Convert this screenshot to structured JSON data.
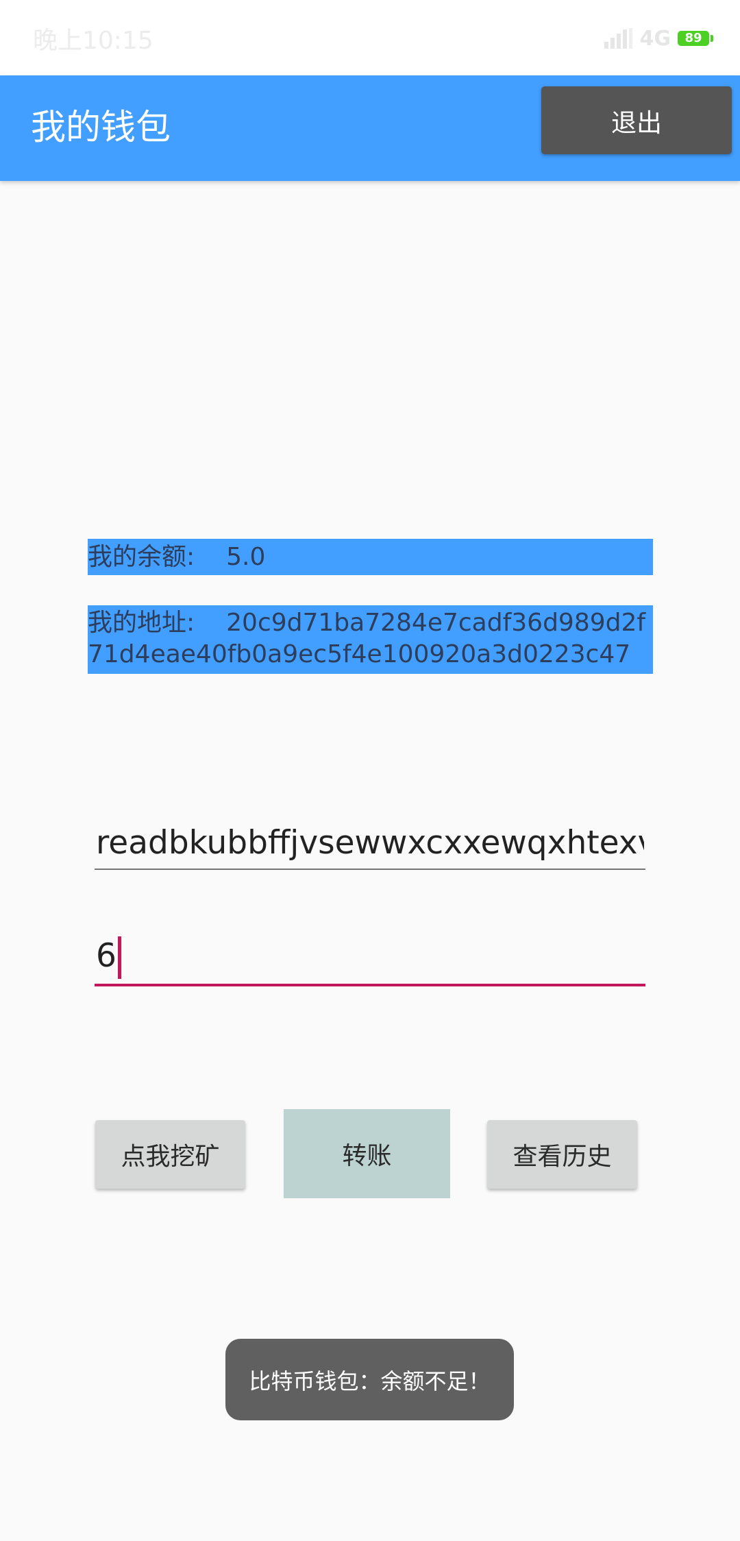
{
  "status_bar": {
    "time": "晚上10:15",
    "network": "4G",
    "battery": "89",
    "icons": [
      "signal-icon",
      "battery-icon"
    ]
  },
  "app_bar": {
    "title": "我的钱包",
    "logout_label": "退出",
    "color": "#429EFF"
  },
  "wallet": {
    "balance_label": "我的余额:",
    "balance_value": "5.0",
    "address_label": "我的地址:",
    "address_value": "20c9d71ba7284e7cadf36d989d2f71d4eae40fb0a9ec5f4e100920a3d0223c47"
  },
  "form": {
    "recipient_value": "readbkubbffjvsewwxcxxewqxhtexvu",
    "amount_value": "6"
  },
  "buttons": {
    "mine_label": "点我挖矿",
    "transfer_label": "转账",
    "history_label": "查看历史"
  },
  "toast": {
    "message": "比特币钱包：余额不足！"
  }
}
